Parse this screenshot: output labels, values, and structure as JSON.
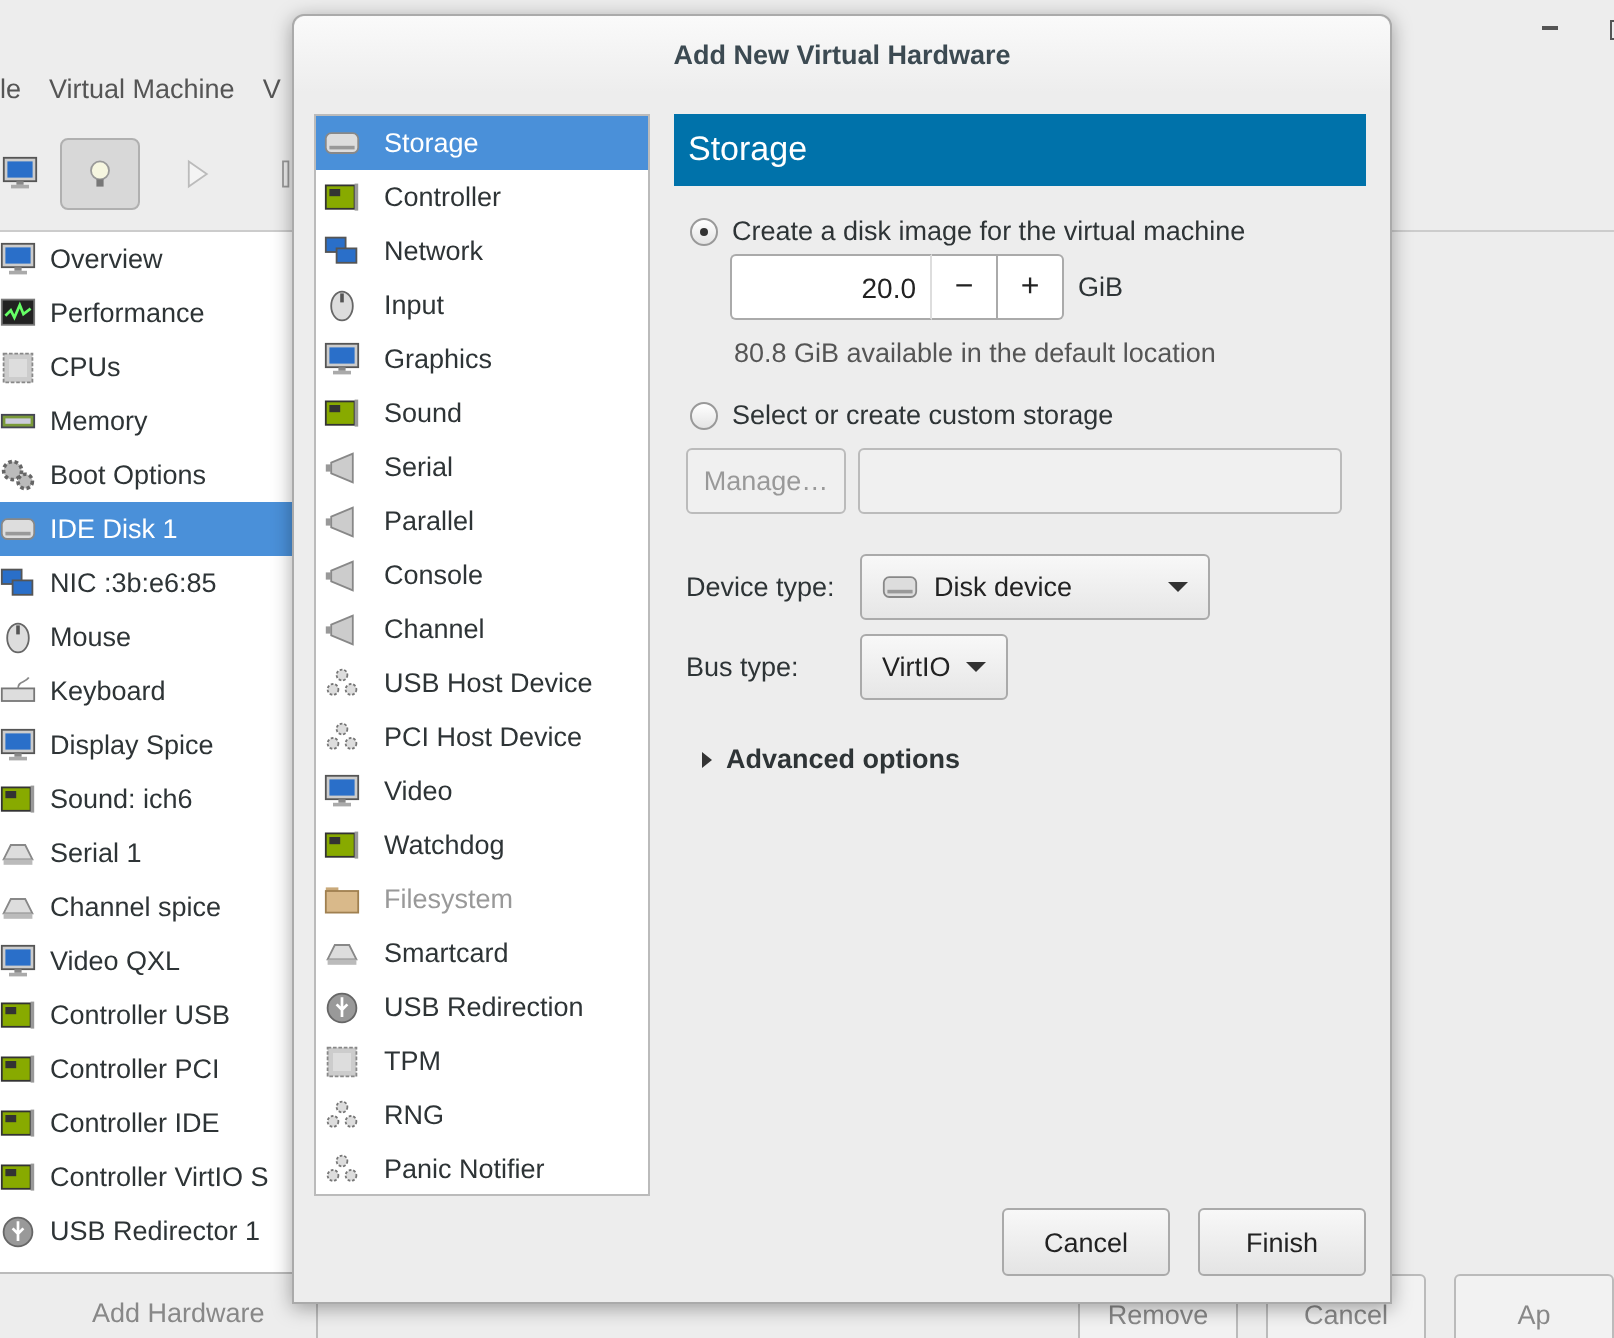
{
  "window": {
    "menu": [
      {
        "label": "le"
      },
      {
        "label": "Virtual Machine"
      },
      {
        "label": "V"
      }
    ],
    "toolbar": [
      {
        "kind": "monitor",
        "selected": false
      },
      {
        "kind": "bulb",
        "selected": true
      },
      {
        "kind": "play",
        "selected": false
      },
      {
        "kind": "pause",
        "selected": false
      }
    ],
    "sidebar": {
      "items": [
        {
          "label": "Overview",
          "kind": "monitor",
          "selected": false
        },
        {
          "label": "Performance",
          "kind": "chart",
          "selected": false
        },
        {
          "label": "CPUs",
          "kind": "chip",
          "selected": false
        },
        {
          "label": "Memory",
          "kind": "memory",
          "selected": false
        },
        {
          "label": "Boot Options",
          "kind": "gear",
          "selected": false
        },
        {
          "label": "IDE Disk 1",
          "kind": "disk",
          "selected": true
        },
        {
          "label": "NIC :3b:e6:85",
          "kind": "network",
          "selected": false
        },
        {
          "label": "Mouse",
          "kind": "mouse",
          "selected": false
        },
        {
          "label": "Keyboard",
          "kind": "keyboard",
          "selected": false
        },
        {
          "label": "Display Spice",
          "kind": "monitor",
          "selected": false
        },
        {
          "label": "Sound: ich6",
          "kind": "card",
          "selected": false
        },
        {
          "label": "Serial 1",
          "kind": "reader",
          "selected": false
        },
        {
          "label": "Channel spice",
          "kind": "reader",
          "selected": false
        },
        {
          "label": "Video QXL",
          "kind": "monitor",
          "selected": false
        },
        {
          "label": "Controller USB",
          "kind": "card",
          "selected": false
        },
        {
          "label": "Controller PCI",
          "kind": "card",
          "selected": false
        },
        {
          "label": "Controller IDE",
          "kind": "card",
          "selected": false
        },
        {
          "label": "Controller VirtIO S",
          "kind": "card",
          "selected": false
        },
        {
          "label": "USB Redirector 1",
          "kind": "usb",
          "selected": false
        }
      ],
      "add_button": "Add Hardware"
    },
    "buttons": [
      {
        "label": "Remove"
      },
      {
        "label": "Cancel"
      },
      {
        "label": "Ap"
      }
    ]
  },
  "dialog": {
    "title": "Add New Virtual Hardware",
    "categories": [
      {
        "label": "Storage",
        "kind": "disk",
        "selected": true,
        "disabled": false
      },
      {
        "label": "Controller",
        "kind": "card",
        "selected": false,
        "disabled": false
      },
      {
        "label": "Network",
        "kind": "network",
        "selected": false,
        "disabled": false
      },
      {
        "label": "Input",
        "kind": "mouse",
        "selected": false,
        "disabled": false
      },
      {
        "label": "Graphics",
        "kind": "monitor",
        "selected": false,
        "disabled": false
      },
      {
        "label": "Sound",
        "kind": "card",
        "selected": false,
        "disabled": false
      },
      {
        "label": "Serial",
        "kind": "plug",
        "selected": false,
        "disabled": false
      },
      {
        "label": "Parallel",
        "kind": "plug",
        "selected": false,
        "disabled": false
      },
      {
        "label": "Console",
        "kind": "plug",
        "selected": false,
        "disabled": false
      },
      {
        "label": "Channel",
        "kind": "plug",
        "selected": false,
        "disabled": false
      },
      {
        "label": "USB Host Device",
        "kind": "gears",
        "selected": false,
        "disabled": false
      },
      {
        "label": "PCI Host Device",
        "kind": "gears",
        "selected": false,
        "disabled": false
      },
      {
        "label": "Video",
        "kind": "monitor",
        "selected": false,
        "disabled": false
      },
      {
        "label": "Watchdog",
        "kind": "card",
        "selected": false,
        "disabled": false
      },
      {
        "label": "Filesystem",
        "kind": "folder",
        "selected": false,
        "disabled": true
      },
      {
        "label": "Smartcard",
        "kind": "reader",
        "selected": false,
        "disabled": false
      },
      {
        "label": "USB Redirection",
        "kind": "usb",
        "selected": false,
        "disabled": false
      },
      {
        "label": "TPM",
        "kind": "chip",
        "selected": false,
        "disabled": false
      },
      {
        "label": "RNG",
        "kind": "gears",
        "selected": false,
        "disabled": false
      },
      {
        "label": "Panic Notifier",
        "kind": "gears",
        "selected": false,
        "disabled": false
      }
    ],
    "panel": {
      "heading": "Storage",
      "options": [
        {
          "label": "Create a disk image for the virtual machine",
          "selected": true
        },
        {
          "label": "Select or create custom storage",
          "selected": false
        }
      ],
      "size": {
        "value": "20.0",
        "decrement": "−",
        "increment": "+",
        "unit": "GiB"
      },
      "available": "80.8 GiB available in the default location",
      "manage_button": {
        "label": "Manage…",
        "disabled": true
      },
      "device_type": {
        "label": "Device type:",
        "value": "Disk device",
        "kind": "disk"
      },
      "bus_type": {
        "label": "Bus type:",
        "value": "VirtIO"
      },
      "advanced": {
        "label": "Advanced options",
        "expanded": false
      }
    },
    "buttons": [
      {
        "label": "Cancel"
      },
      {
        "label": "Finish"
      }
    ]
  }
}
